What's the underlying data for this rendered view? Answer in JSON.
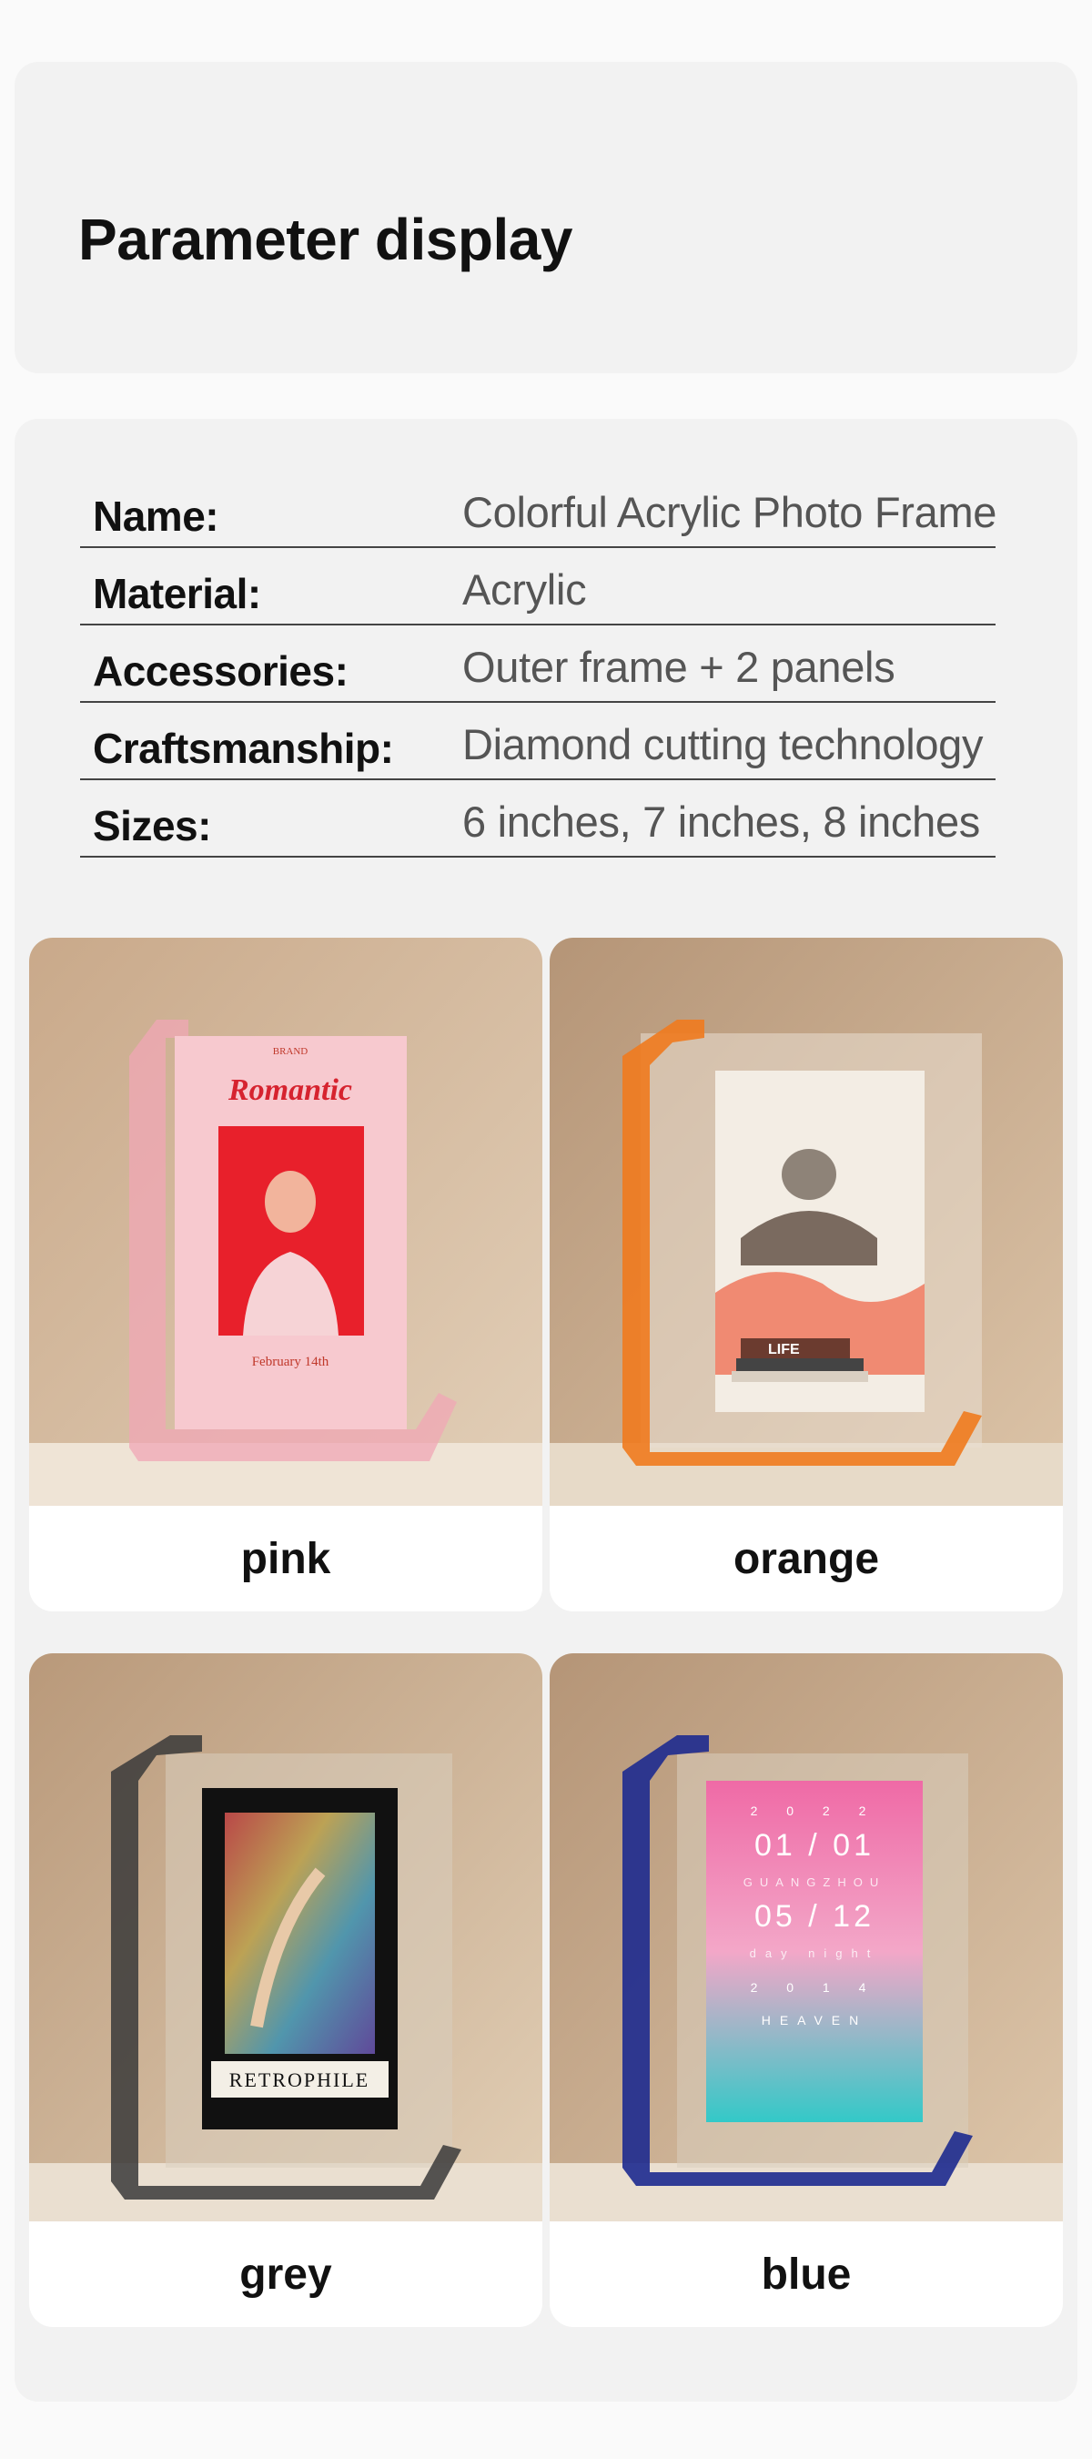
{
  "header": {
    "title": "Parameter display"
  },
  "params": [
    {
      "label": "Name:",
      "value": "Colorful Acrylic Photo Frame"
    },
    {
      "label": "Material:",
      "value": "Acrylic"
    },
    {
      "label": "Accessories:",
      "value": "Outer frame + 2 panels"
    },
    {
      "label": "Craftsmanship:",
      "value": "Diamond cutting technology"
    },
    {
      "label": "Sizes:",
      "value": "6 inches, 7 inches, 8 inches"
    }
  ],
  "variants": [
    {
      "name": "pink",
      "frame_color": "#f0a7b6",
      "insert": {
        "brand": "BRAND",
        "headline": "Romantic",
        "date": "February 14th"
      }
    },
    {
      "name": "orange",
      "frame_color": "#f07a1e",
      "insert": {
        "label": "LIFE"
      }
    },
    {
      "name": "grey",
      "frame_color": "#3a3a3a",
      "insert": {
        "label": "RETROPHILE"
      }
    },
    {
      "name": "blue",
      "frame_color": "#1d2a8f",
      "insert": {
        "row1": "2 0 2 2",
        "row2": "01 / 01",
        "row3": "GUANGZHOU",
        "row4": "05 / 12",
        "row5": "day night",
        "row6": "2 0 1 4",
        "row7": "HEAVEN"
      }
    }
  ],
  "colors": {
    "page_bg": "#fafafa",
    "card_bg": "#f2f2f2",
    "rule": "#444444"
  }
}
